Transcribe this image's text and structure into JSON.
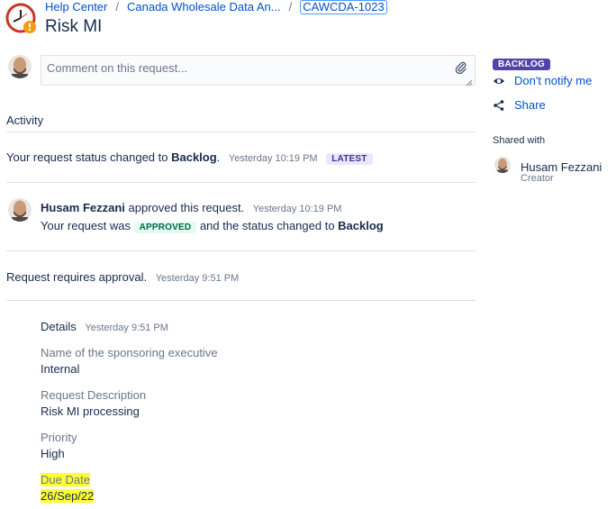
{
  "breadcrumb": {
    "items": [
      "Help Center",
      "Canada Wholesale Data An...",
      "CAWCDA-1023"
    ]
  },
  "page": {
    "title": "Risk MI"
  },
  "comment": {
    "placeholder": "Comment on this request..."
  },
  "activity": {
    "heading": "Activity",
    "events": [
      {
        "text_before": "Your request status changed to ",
        "status": "Backlog",
        "text_after": ".",
        "time": "Yesterday 10:19 PM",
        "badge": "LATEST"
      },
      {
        "user": "Husam Fezzani",
        "action": " approved this request.",
        "time": "Yesterday 10:19 PM",
        "line2_before": "Your request was ",
        "line2_badge": "APPROVED",
        "line2_middle": " and the status changed to ",
        "line2_status": "Backlog"
      },
      {
        "text": "Request requires approval.",
        "time": "Yesterday 9:51 PM"
      }
    ],
    "details": {
      "heading": "Details",
      "time": "Yesterday 9:51 PM",
      "fields": [
        {
          "label": "Name of the sponsoring executive",
          "value": "Internal"
        },
        {
          "label": "Request Description",
          "value": "Risk MI processing"
        },
        {
          "label": "Priority",
          "value": "High"
        },
        {
          "label": "Due Date",
          "value": "26/Sep/22"
        }
      ]
    }
  },
  "sidebar": {
    "status": "BACKLOG",
    "notify_label": "Don't notify me",
    "share_label": "Share",
    "shared_with_label": "Shared with",
    "shared_user": {
      "name": "Husam Fezzani",
      "role": "Creator"
    }
  },
  "colors": {
    "link": "#0052cc",
    "text": "#172b4d",
    "muted": "#6b778c",
    "backlog": "#5243aa",
    "highlight": "#ffff33"
  }
}
